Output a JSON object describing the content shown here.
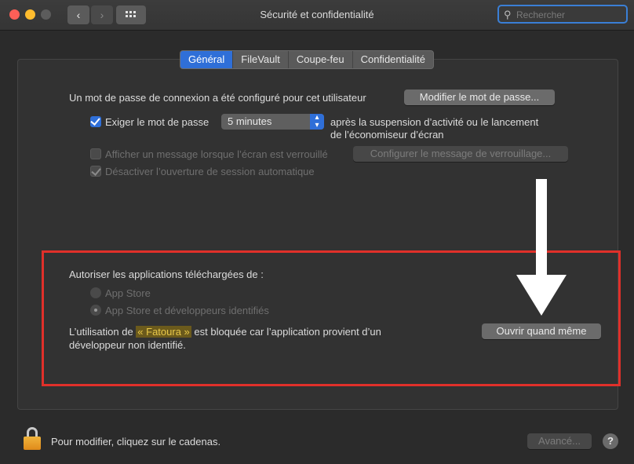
{
  "window": {
    "title": "Sécurité et confidentialité",
    "back_icon": "‹",
    "forward_icon": "›",
    "search_placeholder": "Rechercher"
  },
  "tabs": [
    {
      "label": "Général",
      "active": true
    },
    {
      "label": "FileVault",
      "active": false
    },
    {
      "label": "Coupe-feu",
      "active": false
    },
    {
      "label": "Confidentialité",
      "active": false
    }
  ],
  "general": {
    "password_text": "Un mot de passe de connexion a été configuré pour cet utilisateur",
    "change_password_button": "Modifier le mot de passe...",
    "require_password_label": "Exiger le mot de passe",
    "require_password_delay": "5 minutes",
    "after_sleep_line1": "après la suspension d’activité ou le lancement",
    "after_sleep_line2": "de l’économiseur d’écran",
    "show_message_label": "Afficher un message lorsque l’écran est verrouillé",
    "configure_message_button": "Configurer le message de verrouillage...",
    "disable_autologin_label": "Désactiver l’ouverture de session automatique"
  },
  "apps": {
    "allow_label": "Autoriser les applications téléchargées de :",
    "option_app_store": "App Store",
    "option_app_store_devs": "App Store et développeurs identifiés",
    "blocked_prefix": "L’utilisation de ",
    "blocked_app": "« Fatoura »",
    "blocked_suffix": " est bloquée car l’application provient d’un",
    "blocked_line2": "développeur non identifié.",
    "open_anyway_button": "Ouvrir quand même"
  },
  "footer": {
    "lock_text": "Pour modifier, cliquez sur le cadenas.",
    "advanced_button": "Avancé...",
    "help_label": "?"
  },
  "colors": {
    "accent": "#2f6fd8",
    "annotation_box": "#e0302a",
    "highlight_text": "#e8c84a"
  }
}
